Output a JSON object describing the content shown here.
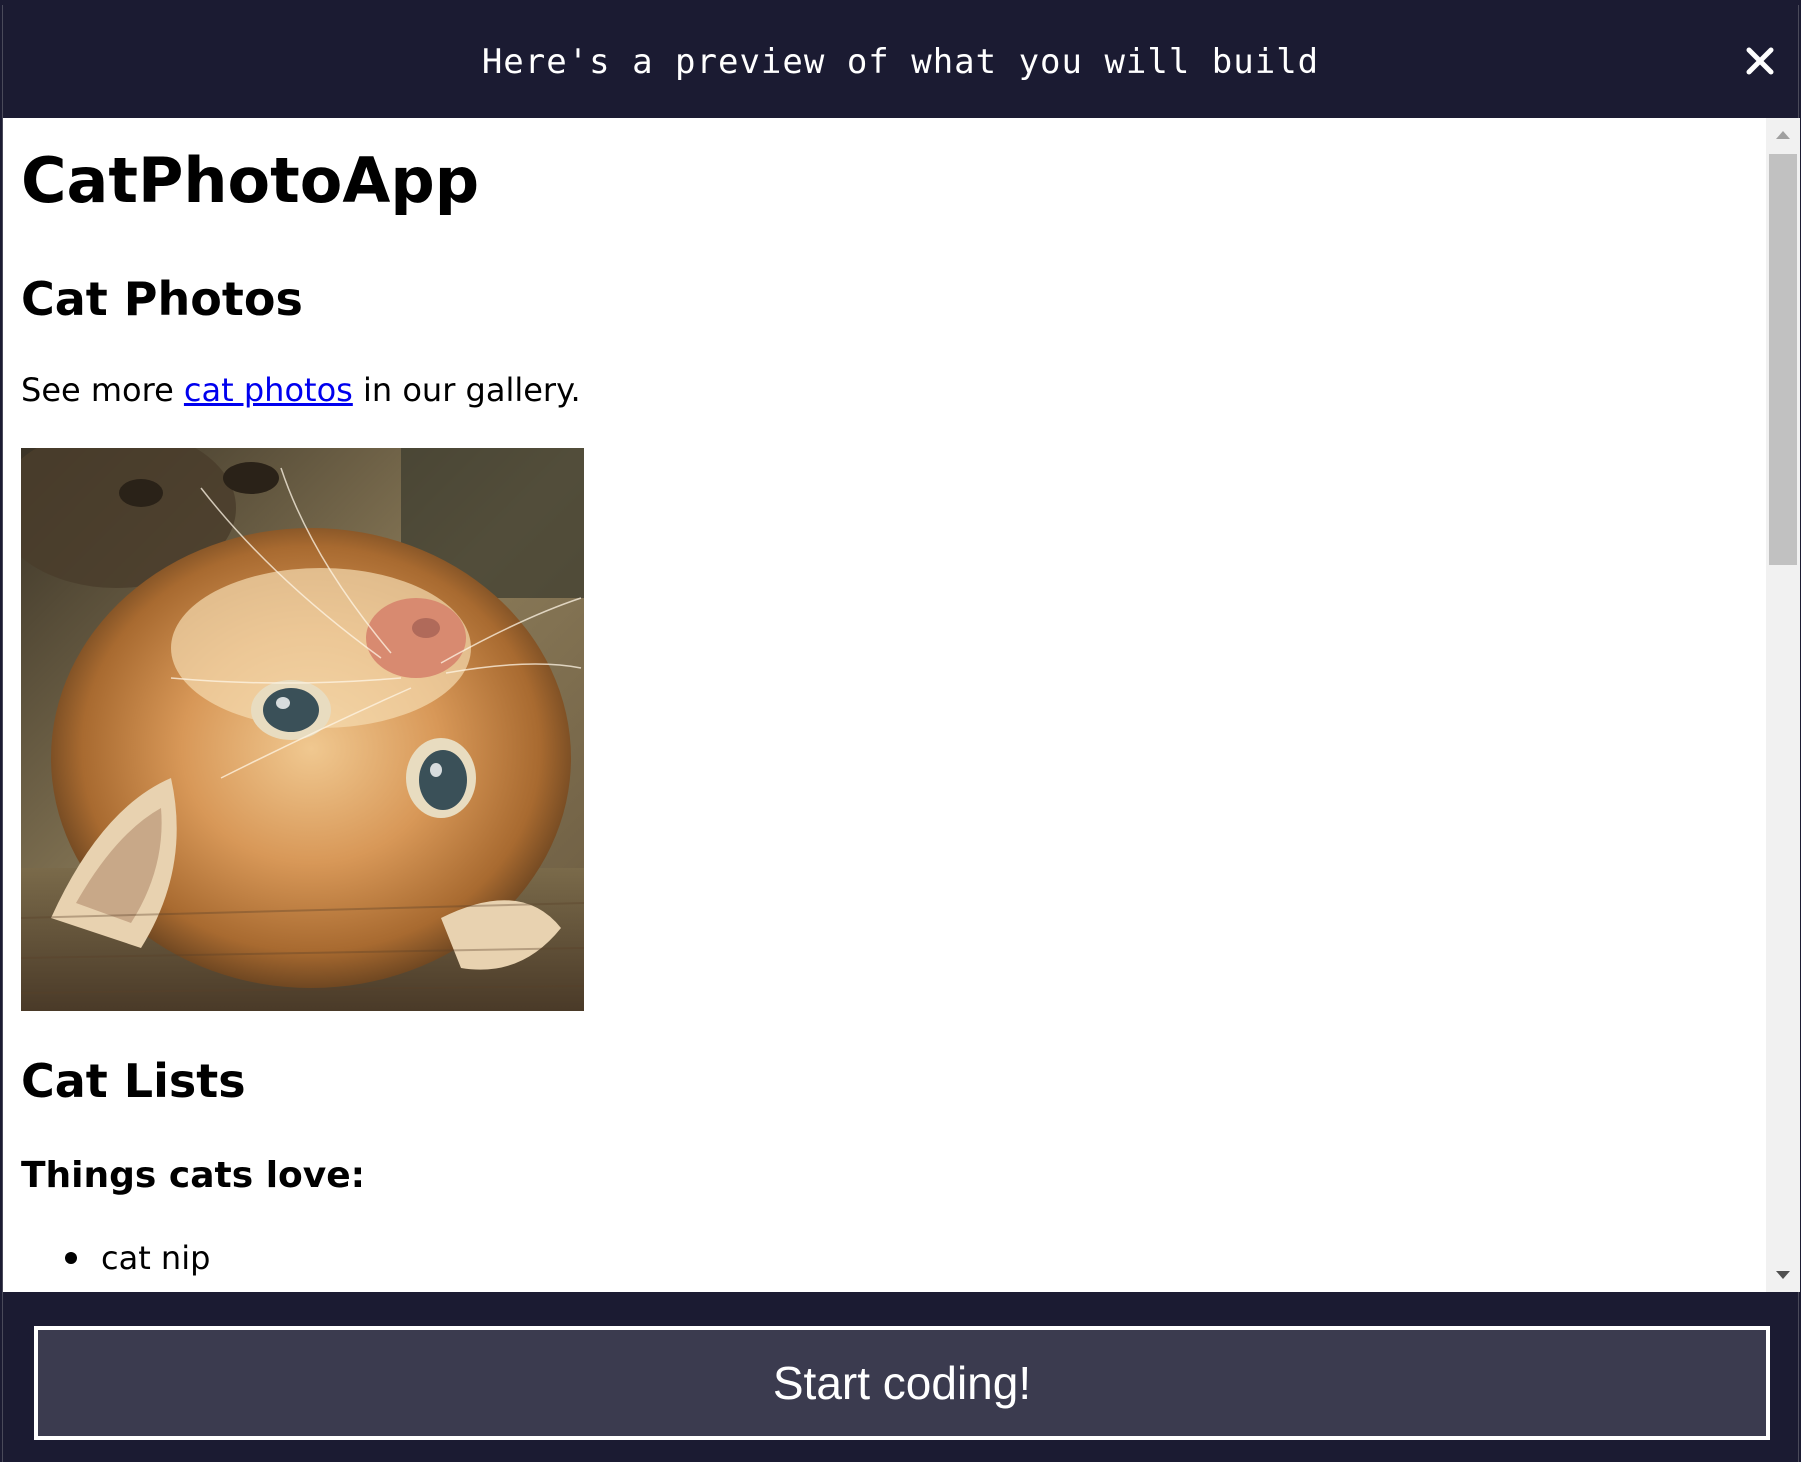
{
  "header": {
    "title": "Here's a preview of what you will build",
    "close_icon": "close-icon"
  },
  "preview": {
    "app_title": "CatPhotoApp",
    "photos_heading": "Cat Photos",
    "gallery_prefix": "See more ",
    "gallery_link": "cat photos",
    "gallery_suffix": " in our gallery.",
    "cat_image": "cat-photo",
    "lists_heading": "Cat Lists",
    "things_heading": "Things cats love:",
    "list_items": [
      "cat nip"
    ]
  },
  "footer": {
    "start_label": "Start coding!"
  },
  "colors": {
    "dark_bg": "#1b1b32",
    "button_bg": "#3b3b4f",
    "link": "#0000ee",
    "white": "#ffffff"
  }
}
